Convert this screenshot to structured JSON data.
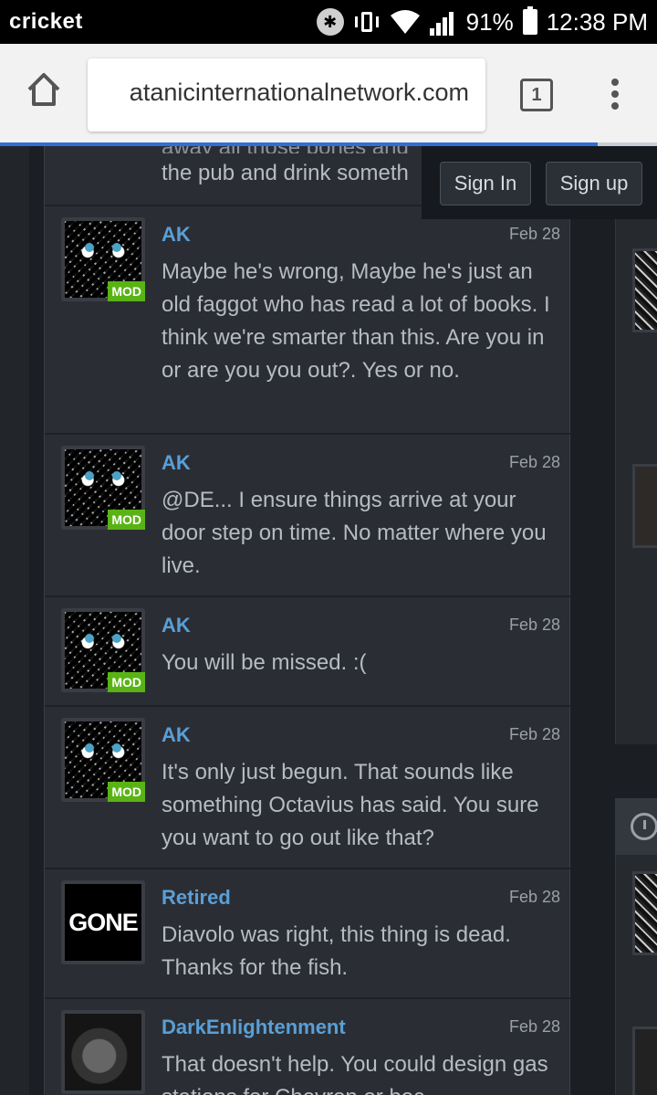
{
  "status_bar": {
    "carrier": "cricket",
    "battery": "91%",
    "time": "12:38 PM"
  },
  "browser": {
    "url": "atanicinternationalnetwork.com",
    "tab_count": "1",
    "load_progress": 0.91
  },
  "auth": {
    "sign_in": "Sign In",
    "sign_up": "Sign up"
  },
  "feed": {
    "partial_message": {
      "text_top": "away all those bones and",
      "text": "the pub and drink someth"
    },
    "messages": [
      {
        "author": "AK",
        "date": "Feb 28",
        "badge": "MOD",
        "text": "Maybe he's wrong, Maybe he's just an old faggot who has read a lot of books. I think we're smarter than this. Are you in or are you you out?. Yes or no."
      },
      {
        "author": "AK",
        "date": "Feb 28",
        "badge": "MOD",
        "text": "@DE... I ensure things arrive at your door step on time. No matter where you live."
      },
      {
        "author": "AK",
        "date": "Feb 28",
        "badge": "MOD",
        "text": "You will be missed. :("
      },
      {
        "author": "AK",
        "date": "Feb 28",
        "badge": "MOD",
        "text": "It's only just begun. That sounds like something Octavius has said. You sure you want to go out like that?"
      },
      {
        "author": "Retired",
        "date": "Feb 28",
        "avatar_text": "GONE",
        "text": "Diavolo was right, this thing is dead. Thanks for the fish."
      },
      {
        "author": "DarkEnlightenment",
        "date": "Feb 28",
        "text": "That doesn't help. You could design gas stations for Chevron or bec"
      }
    ]
  },
  "icons": {
    "home": "home-icon",
    "menu": "more-vert-icon",
    "clock": "clock-icon",
    "bluetooth": "bluetooth-icon",
    "wifi": "wifi-icon"
  },
  "colors": {
    "author": "#5a9fd6",
    "mod_badge": "#59b314",
    "page_bg": "#1b1e23",
    "progress": "#2f6fd6"
  }
}
